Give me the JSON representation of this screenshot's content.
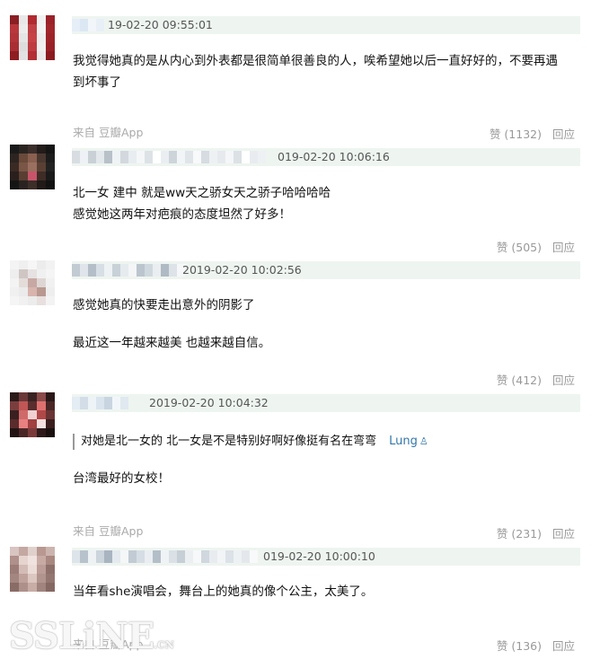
{
  "colors": {
    "meta_bar_bg": "#eef5f0",
    "text": "#111111",
    "muted": "#999999",
    "link": "#3377aa"
  },
  "comments": [
    {
      "timestamp": "19-02-20 09:55:01",
      "lines": [
        "我觉得她真的是从内心到外表都是很简单很善良的人，唉希望她以后一直好好的，不要再遇",
        "到坏事了"
      ],
      "source": "来自 豆瓣App",
      "likes": "赞 (1132)",
      "reply": "回应"
    },
    {
      "timestamp": "019-02-20 10:06:16",
      "lines": [
        "北一女 建中 就是ww天之骄女天之骄子哈哈哈哈",
        "感觉她这两年对疤痕的态度坦然了好多！"
      ],
      "likes": "赞 (505)",
      "reply": "回应"
    },
    {
      "timestamp": "2019-02-20 10:02:56",
      "lines": [
        "感觉她真的快要走出意外的阴影了",
        "最近这一年越来越美 也越来越自信。"
      ],
      "likes": "赞 (412)",
      "reply": "回应"
    },
    {
      "timestamp": "2019-02-20 10:04:32",
      "quote": "对她是北一女的 北一女是不是特别好啊好像挺有名在弯弯",
      "quote_author": "Lung",
      "lines": [
        "台湾最好的女校！"
      ],
      "source": "来自 豆瓣App",
      "likes": "赞 (231)",
      "reply": "回应"
    },
    {
      "timestamp": "019-02-20 10:00:10",
      "lines": [
        "当年看she演唱会，舞台上的她真的像个公主，太美了。"
      ],
      "source": "来自 豆瓣App",
      "likes": "赞 (136)",
      "reply": "回应"
    }
  ],
  "watermark": {
    "main": "SSLiNE",
    "suffix": ".CN"
  }
}
